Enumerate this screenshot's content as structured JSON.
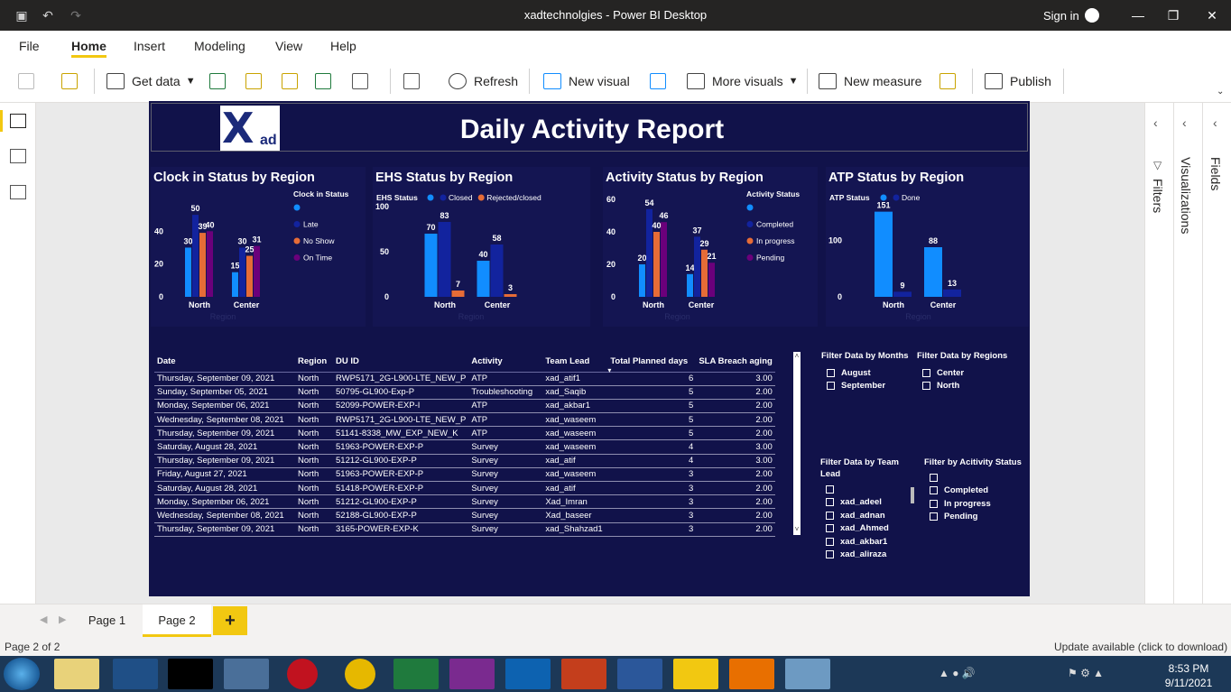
{
  "window": {
    "title": "xadtechnolgies - Power BI Desktop",
    "signin": "Sign in"
  },
  "menu": {
    "tabs": [
      "File",
      "Home",
      "Insert",
      "Modeling",
      "View",
      "Help"
    ],
    "active": "Home"
  },
  "ribbon": {
    "get_data": "Get data",
    "refresh": "Refresh",
    "new_visual": "New visual",
    "more_visuals": "More visuals",
    "new_measure": "New measure",
    "publish": "Publish"
  },
  "report": {
    "title": "Daily Activity Report",
    "logo_text": {
      "x": "X",
      "ad": "ad"
    }
  },
  "charts": {
    "clock_in": {
      "title": "Clock in Status by Region",
      "legend_title": "Clock in Status",
      "axis_title": "Region",
      "legend": [
        {
          "name": "",
          "color": "#118dff"
        },
        {
          "name": "Late",
          "color": "#12239e"
        },
        {
          "name": "No Show",
          "color": "#e66c37"
        },
        {
          "name": "On Time",
          "color": "#6b007b"
        }
      ],
      "yticks": [
        "0",
        "20",
        "40"
      ]
    },
    "ehs": {
      "title": "EHS Status by Region",
      "legend_title": "EHS Status",
      "axis_title": "Region",
      "legend": [
        {
          "name": "",
          "color": "#118dff"
        },
        {
          "name": "Closed",
          "color": "#12239e"
        },
        {
          "name": "Rejected/closed",
          "color": "#e66c37"
        }
      ],
      "yticks": [
        "0",
        "50",
        "100"
      ]
    },
    "activity": {
      "title": "Activity Status by Region",
      "legend_title": "Activity Status",
      "axis_title": "Region",
      "legend": [
        {
          "name": "",
          "color": "#118dff"
        },
        {
          "name": "Completed",
          "color": "#12239e"
        },
        {
          "name": "In progress",
          "color": "#e66c37"
        },
        {
          "name": "Pending",
          "color": "#6b007b"
        }
      ],
      "yticks": [
        "0",
        "20",
        "40",
        "60"
      ]
    },
    "atp": {
      "title": "ATP Status by Region",
      "legend_title": "ATP Status",
      "axis_title": "Region",
      "legend": [
        {
          "name": "",
          "color": "#118dff"
        },
        {
          "name": "Done",
          "color": "#12239e"
        }
      ],
      "yticks": [
        "0",
        "100"
      ]
    }
  },
  "chart_data": [
    {
      "type": "bar",
      "title": "Clock in Status by Region",
      "categories": [
        "North",
        "Center"
      ],
      "ylim": [
        0,
        55
      ],
      "series": [
        {
          "name": "",
          "values": [
            30,
            15
          ]
        },
        {
          "name": "Late",
          "values": [
            50,
            30
          ]
        },
        {
          "name": "No Show",
          "values": [
            39,
            25
          ]
        },
        {
          "name": "On Time",
          "values": [
            40,
            31
          ]
        }
      ]
    },
    {
      "type": "bar",
      "title": "EHS Status by Region",
      "categories": [
        "North",
        "Center"
      ],
      "ylim": [
        0,
        100
      ],
      "series": [
        {
          "name": "",
          "values": [
            70,
            40
          ]
        },
        {
          "name": "Closed",
          "values": [
            83,
            58
          ]
        },
        {
          "name": "Rejected/closed",
          "values": [
            7,
            3
          ]
        }
      ]
    },
    {
      "type": "bar",
      "title": "Activity Status by Region",
      "categories": [
        "North",
        "Center"
      ],
      "ylim": [
        0,
        60
      ],
      "series": [
        {
          "name": "",
          "values": [
            20,
            14
          ]
        },
        {
          "name": "Completed",
          "values": [
            54,
            37
          ]
        },
        {
          "name": "In progress",
          "values": [
            40,
            29
          ]
        },
        {
          "name": "Pending",
          "values": [
            46,
            21
          ]
        }
      ]
    },
    {
      "type": "bar",
      "title": "ATP Status by Region",
      "categories": [
        "North",
        "Center"
      ],
      "ylim": [
        0,
        160
      ],
      "series": [
        {
          "name": "",
          "values": [
            151,
            88
          ]
        },
        {
          "name": "Done",
          "values": [
            9,
            13
          ]
        }
      ]
    }
  ],
  "table": {
    "columns": [
      "Date",
      "Region",
      "DU ID",
      "Activity",
      "Team Lead",
      "Total Planned days",
      "SLA Breach aging"
    ],
    "rows": [
      [
        "Thursday, September 09, 2021",
        "North",
        "RWP5171_2G-L900-LTE_NEW_P",
        "ATP",
        "xad_atif1",
        "6",
        "3.00"
      ],
      [
        "Sunday, September 05, 2021",
        "North",
        "50795-GL900-Exp-P",
        "Troubleshooting",
        "xad_Saqib",
        "5",
        "2.00"
      ],
      [
        "Monday, September 06, 2021",
        "North",
        "52099-POWER-EXP-I",
        "ATP",
        "xad_akbar1",
        "5",
        "2.00"
      ],
      [
        "Wednesday, September 08, 2021",
        "North",
        "RWP5171_2G-L900-LTE_NEW_P",
        "ATP",
        "xad_waseem",
        "5",
        "2.00"
      ],
      [
        "Thursday, September 09, 2021",
        "North",
        "51141-8338_MW_EXP_NEW_K",
        "ATP",
        "xad_waseem",
        "5",
        "2.00"
      ],
      [
        "Saturday, August 28, 2021",
        "North",
        "51963-POWER-EXP-P",
        "Survey",
        "xad_waseem",
        "4",
        "3.00"
      ],
      [
        "Thursday, September 09, 2021",
        "North",
        "51212-GL900-EXP-P",
        "Survey",
        "xad_atif",
        "4",
        "3.00"
      ],
      [
        "Friday, August 27, 2021",
        "North",
        "51963-POWER-EXP-P",
        "Survey",
        "xad_waseem",
        "3",
        "2.00"
      ],
      [
        "Saturday, August 28, 2021",
        "North",
        "51418-POWER-EXP-P",
        "Survey",
        "xad_atif",
        "3",
        "2.00"
      ],
      [
        "Monday, September 06, 2021",
        "North",
        "51212-GL900-EXP-P",
        "Survey",
        "Xad_Imran",
        "3",
        "2.00"
      ],
      [
        "Wednesday, September 08, 2021",
        "North",
        "52188-GL900-EXP-P",
        "Survey",
        "Xad_baseer",
        "3",
        "2.00"
      ],
      [
        "Thursday, September 09, 2021",
        "North",
        "3165-POWER-EXP-K",
        "Survey",
        "xad_Shahzad1",
        "3",
        "2.00"
      ]
    ]
  },
  "slicers": {
    "months": {
      "title": "Filter Data by Months",
      "items": [
        "August",
        "September"
      ]
    },
    "regions": {
      "title": "Filter Data by Regions",
      "items": [
        "Center",
        "North"
      ]
    },
    "team_lead": {
      "title": "Filter Data by Team Lead",
      "items": [
        "",
        "xad_adeel",
        "xad_adnan",
        "xad_Ahmed",
        "xad_akbar1",
        "xad_aliraza"
      ]
    },
    "activity": {
      "title": "Filter by Acitivity Status",
      "items": [
        "",
        "Completed",
        "In progress",
        "Pending"
      ]
    }
  },
  "pages": {
    "tabs": [
      "Page 1",
      "Page 2"
    ],
    "active": "Page 2",
    "add": "+"
  },
  "status": {
    "page": "Page 2 of 2",
    "update": "Update available (click to download)"
  },
  "panes": {
    "filters": "Filters",
    "visualizations": "Visualizations",
    "fields": "Fields"
  },
  "clock": {
    "time": "8:53 PM",
    "date": "9/11/2021"
  },
  "colors": {
    "report_bg": "#11124a",
    "accent": "#f2c811"
  }
}
